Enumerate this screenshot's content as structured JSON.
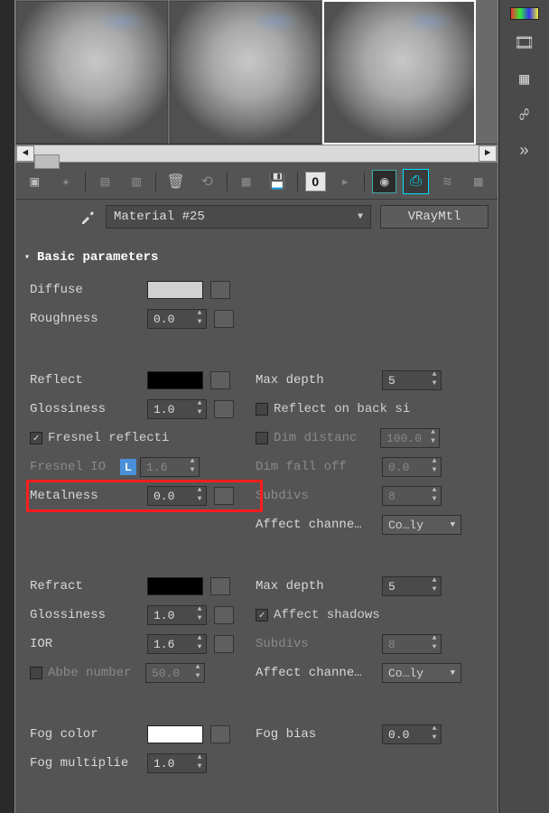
{
  "right_icons": [
    "palette-icon",
    "film-icon",
    "checker-icon",
    "link-icon",
    "chevron-down-icon"
  ],
  "toolbar_icons": [
    "get-material",
    "assign",
    "sep",
    "put-scene",
    "sep",
    "delete",
    "reset",
    "sep",
    "make-unique",
    "save",
    "sep",
    "zero",
    "play",
    "sep",
    "can",
    "checker",
    "dark"
  ],
  "material": {
    "name": "Material #25",
    "type": "VRayMtl"
  },
  "rollout_title": "Basic parameters",
  "diffuse_label": "Diffuse",
  "roughness": {
    "label": "Roughness",
    "value": "0.0"
  },
  "reflect": {
    "label": "Reflect",
    "glossiness": {
      "label": "Glossiness",
      "value": "1.0"
    },
    "fresnel": {
      "label": "Fresnel reflecti",
      "checked": true
    },
    "fresnel_ior": {
      "label": "Fresnel IO",
      "value": "1.6",
      "locked_badge": "L"
    },
    "metalness": {
      "label": "Metalness",
      "value": "0.0"
    },
    "max_depth": {
      "label": "Max depth",
      "value": "5"
    },
    "reflect_back": {
      "label": "Reflect on back si",
      "checked": false
    },
    "dim_distance": {
      "label": "Dim distanc",
      "value": "100.0",
      "checked": false
    },
    "dim_falloff": {
      "label": "Dim fall off",
      "value": "0.0"
    },
    "subdivs": {
      "label": "Subdivs",
      "value": "8"
    },
    "affect": {
      "label": "Affect channe…",
      "value": "Co…ly"
    }
  },
  "refract": {
    "label": "Refract",
    "glossiness": {
      "label": "Glossiness",
      "value": "1.0"
    },
    "ior": {
      "label": "IOR",
      "value": "1.6"
    },
    "abbe": {
      "label": "Abbe number",
      "value": "50.0",
      "checked": false
    },
    "max_depth": {
      "label": "Max depth",
      "value": "5"
    },
    "affect_shadows": {
      "label": "Affect shadows",
      "checked": true
    },
    "subdivs": {
      "label": "Subdivs",
      "value": "8"
    },
    "affect": {
      "label": "Affect channe…",
      "value": "Co…ly"
    }
  },
  "fog": {
    "color_label": "Fog color",
    "mult": {
      "label": "Fog multiplie",
      "value": "1.0"
    },
    "bias": {
      "label": "Fog bias",
      "value": "0.0"
    }
  }
}
